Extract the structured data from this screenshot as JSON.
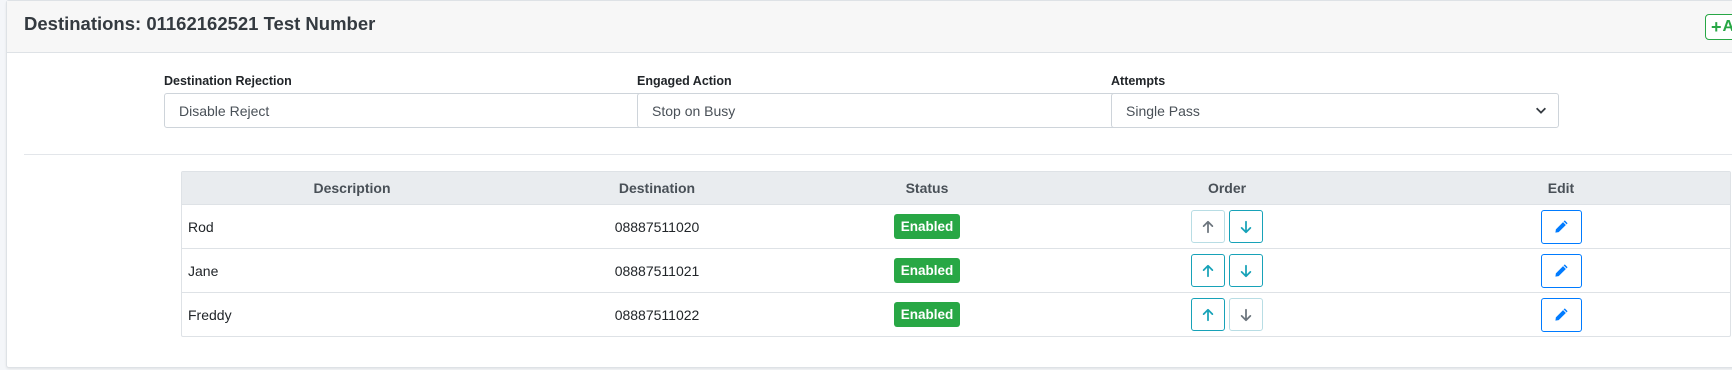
{
  "header": {
    "title": "Destinations: 01162162521 Test Number",
    "add_label": "A"
  },
  "filters": [
    {
      "label": "Destination Rejection",
      "value": "Disable Reject"
    },
    {
      "label": "Engaged Action",
      "value": "Stop on Busy"
    },
    {
      "label": "Attempts",
      "value": "Single Pass"
    }
  ],
  "table": {
    "columns": [
      "Description",
      "Destination",
      "Status",
      "Order",
      "Edit"
    ],
    "rows": [
      {
        "description": "Rod",
        "destination": "08887511020",
        "status": "Enabled",
        "up_enabled": false,
        "down_enabled": true
      },
      {
        "description": "Jane",
        "destination": "08887511021",
        "status": "Enabled",
        "up_enabled": true,
        "down_enabled": true
      },
      {
        "description": "Freddy",
        "destination": "08887511022",
        "status": "Enabled",
        "up_enabled": true,
        "down_enabled": false
      }
    ]
  },
  "icons": {
    "add": "plus-icon",
    "select": "chevron-down-icon",
    "order_up": "arrow-up-icon",
    "order_down": "arrow-down-icon",
    "edit": "pencil-icon"
  },
  "colors": {
    "enabled_badge": "#28a745",
    "order_button": "#17a2b8",
    "order_icon_disabled": "#6c757d",
    "edit_button": "#007bff",
    "add_button": "#28a745"
  }
}
